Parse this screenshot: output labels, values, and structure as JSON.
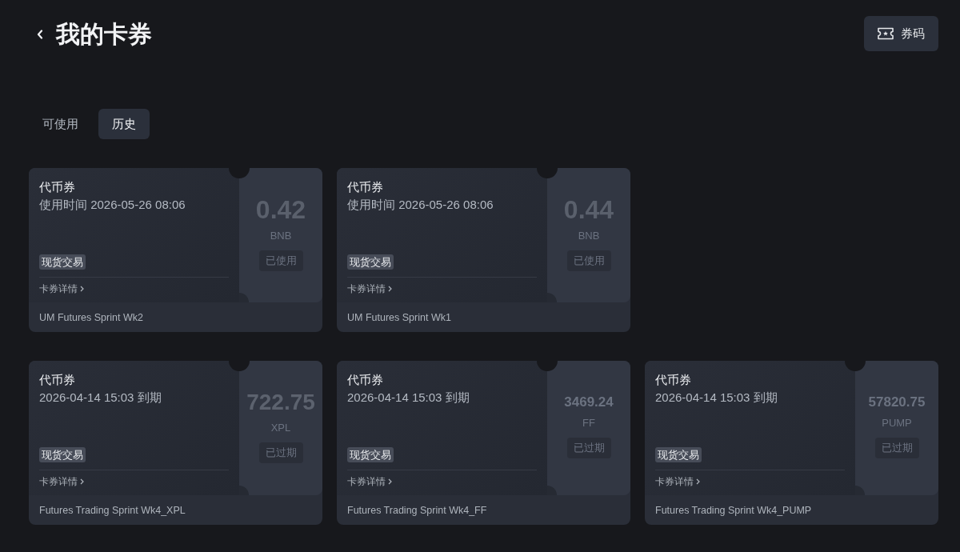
{
  "header": {
    "title": "我的卡券",
    "code_button": {
      "label": "券码"
    }
  },
  "tabs": [
    {
      "label": "可使用",
      "selected": false
    },
    {
      "label": "历史",
      "selected": true
    }
  ],
  "coupon_rows": [
    [
      {
        "type": "代币券",
        "time": "使用时间 2026-05-26 08:06",
        "tag": "现货交易",
        "details_link": "卡券详情",
        "name": "UM Futures Sprint Wk2",
        "amount": "0.42",
        "unit": "BNB",
        "status": "已使用"
      },
      {
        "type": "代币券",
        "time": "使用时间 2026-05-26 08:06",
        "tag": "现货交易",
        "details_link": "卡券详情",
        "name": "UM Futures Sprint Wk1",
        "amount": "0.44",
        "unit": "BNB",
        "status": "已使用"
      }
    ],
    [
      {
        "type": "代币券",
        "time": "2026-04-14 15:03 到期",
        "tag": "现货交易",
        "details_link": "卡券详情",
        "name": "Futures Trading Sprint Wk4_XPL",
        "amount": "722.75",
        "unit": "XPL",
        "status": "已过期"
      },
      {
        "type": "代币券",
        "time": "2026-04-14 15:03 到期",
        "tag": "现货交易",
        "details_link": "卡券详情",
        "name": "Futures Trading Sprint Wk4_FF",
        "amount": "3469.24",
        "unit": "FF",
        "status": "已过期"
      },
      {
        "type": "代币券",
        "time": "2026-04-14 15:03 到期",
        "tag": "现货交易",
        "details_link": "卡券详情",
        "name": "Futures Trading Sprint Wk4_PUMP",
        "amount": "57820.75",
        "unit": "PUMP",
        "status": "已过期"
      }
    ]
  ]
}
